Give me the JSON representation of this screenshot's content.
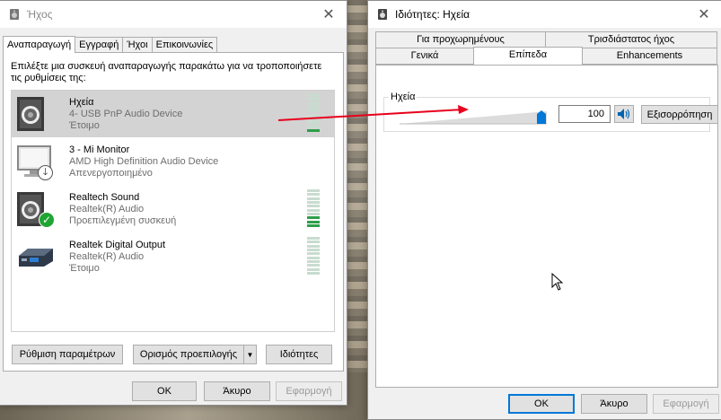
{
  "sound_window": {
    "title": "Ήχος",
    "tabs": [
      "Αναπαραγωγή",
      "Εγγραφή",
      "Ήχοι",
      "Επικοινωνίες"
    ],
    "instructions": "Επιλέξτε μια συσκευή αναπαραγωγής παρακάτω για να τροποποιήσετε τις ρυθμίσεις της:",
    "devices": [
      {
        "name": "Ηχεία",
        "description": "4- USB PnP Audio Device",
        "status": "Έτοιμο",
        "icon": "speaker-icon",
        "meter_level": 0.1,
        "selected": true
      },
      {
        "name": "3 - Mi Monitor",
        "description": "AMD High Definition Audio Device",
        "status": "Απενεργοποιημένο",
        "icon": "monitor-icon",
        "badge": "down-arrow-badge"
      },
      {
        "name": "Realtech Sound",
        "description": "Realtek(R) Audio",
        "status": "Προεπιλεγμένη συσκευή",
        "icon": "speaker-icon",
        "badge": "check-badge",
        "meter_level": 0.3
      },
      {
        "name": "Realtek Digital Output",
        "description": "Realtek(R) Audio",
        "status": "Έτοιμο",
        "icon": "digital-output-icon",
        "meter_level": 0
      }
    ],
    "buttons": {
      "configure": "Ρύθμιση παραμέτρων",
      "set_default": "Ορισμός προεπιλογής",
      "properties": "Ιδιότητες",
      "ok": "OK",
      "cancel": "Άκυρο",
      "apply": "Εφαρμογή"
    }
  },
  "properties_window": {
    "title": "Ιδιότητες: Ηχεία",
    "tabs_row1": [
      "Για προχωρημένους",
      "Τρισδιάστατος ήχος"
    ],
    "tabs_row2": [
      "Γενικά",
      "Επίπεδα",
      "Enhancements"
    ],
    "active_tab": "Επίπεδα",
    "levels": {
      "group_label": "Ηχεία",
      "volume": "100",
      "volume_level": 1.0,
      "balance_button": "Εξισορρόπηση"
    },
    "buttons": {
      "ok": "OK",
      "cancel": "Άκυρο",
      "apply": "Εφαρμογή"
    }
  },
  "colors": {
    "accent": "#0078d7",
    "annotation_arrow": "#e8001c",
    "meter_on": "#2e9e4a"
  }
}
